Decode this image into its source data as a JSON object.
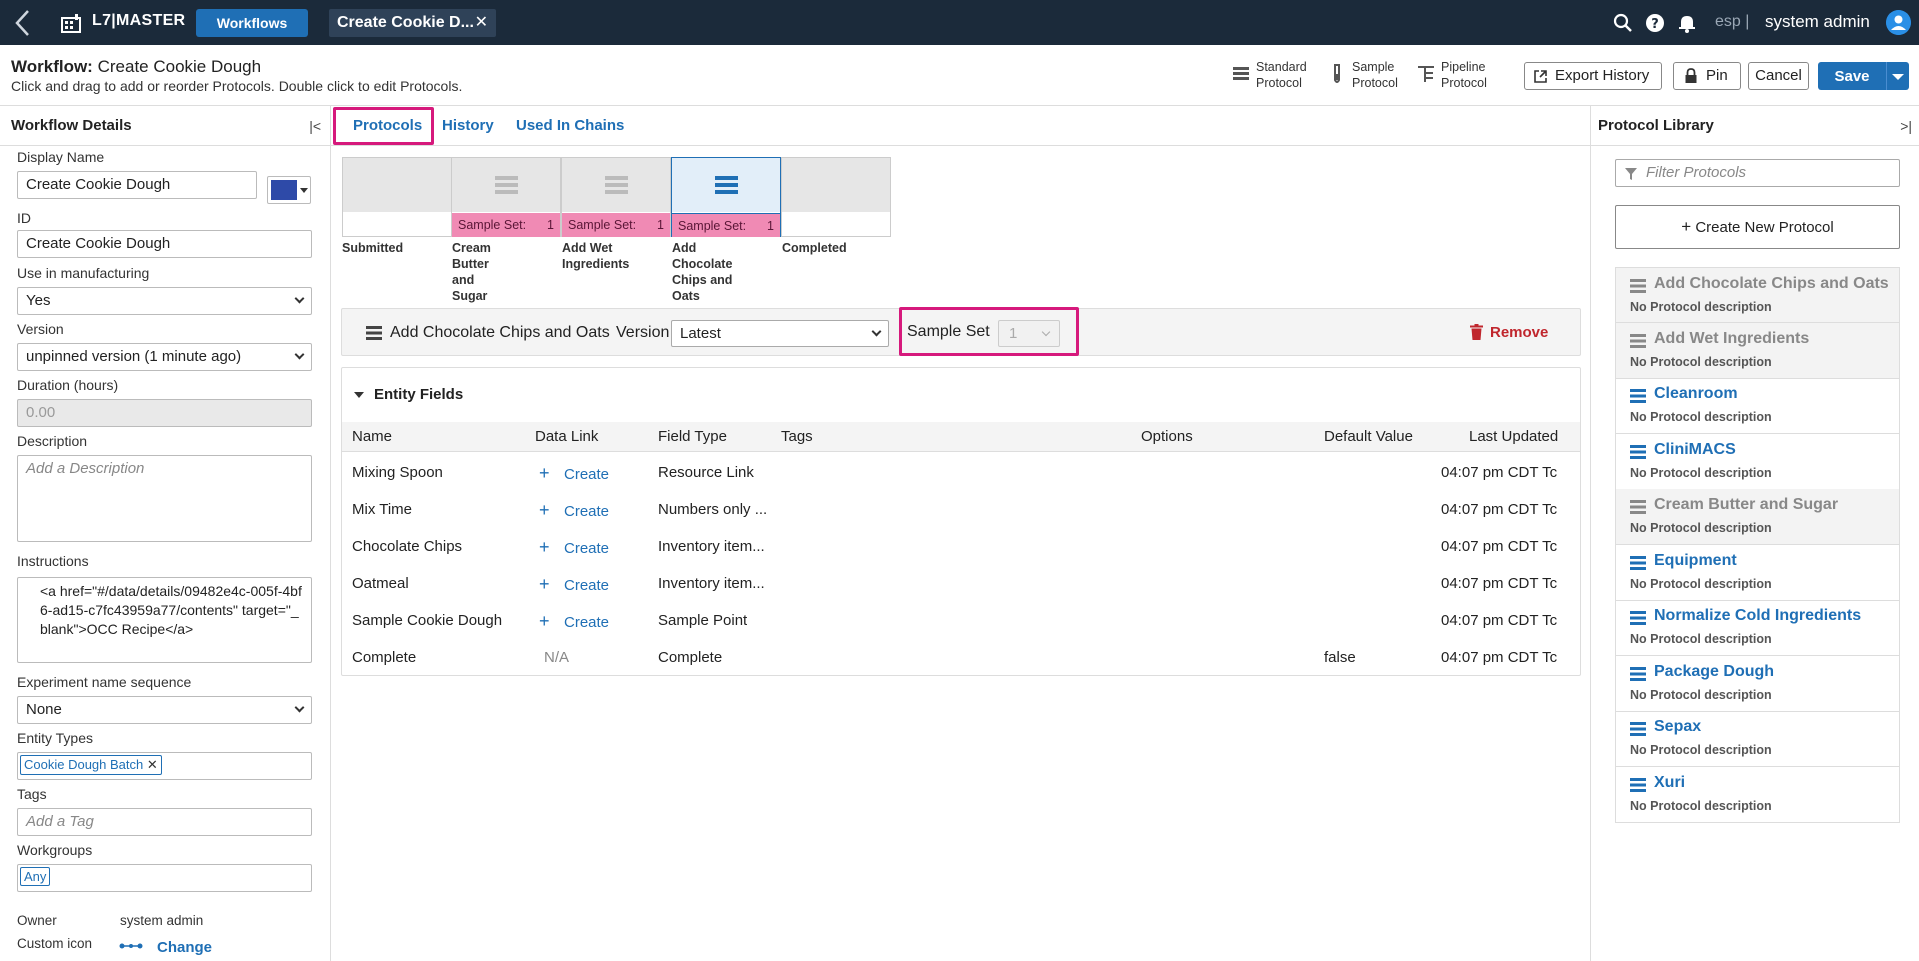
{
  "topbar": {
    "brand": "L7|MASTER",
    "workflows_button": "Workflows",
    "active_tab": "Create Cookie D...",
    "esp": "esp |",
    "user": "system admin",
    "icons": [
      "back-icon",
      "app-logo-icon",
      "close-icon",
      "search-icon",
      "help-icon",
      "bell-icon",
      "avatar-icon"
    ]
  },
  "header": {
    "workflow_label": "Workflow:",
    "workflow_name": "Create Cookie Dough",
    "hint": "Click and drag to add or reorder Protocols. Double click to edit Protocols.",
    "protocol_types": [
      {
        "line1": "Standard",
        "line2": "Protocol"
      },
      {
        "line1": "Sample",
        "line2": "Protocol"
      },
      {
        "line1": "Pipeline",
        "line2": "Protocol"
      }
    ],
    "export_history": "Export History",
    "pin": "Pin",
    "cancel": "Cancel",
    "save": "Save"
  },
  "left": {
    "title": "Workflow Details",
    "display_name_label": "Display Name",
    "display_name": "Create Cookie Dough",
    "color": "#2e4aa8",
    "id_label": "ID",
    "id": "Create Cookie Dough",
    "manufacturing_label": "Use in manufacturing",
    "manufacturing": "Yes",
    "version_label": "Version",
    "version": "unpinned version (1 minute ago)",
    "duration_label": "Duration (hours)",
    "duration": "0.00",
    "description_label": "Description",
    "description_placeholder": "Add a Description",
    "instructions_label": "Instructions",
    "instructions": "<a href=\"#/data/details/09482e4c-005f-4bf6-ad15-c7fc43959a77/contents\" target=\"_blank\">OCC Recipe</a>",
    "sequence_label": "Experiment name sequence",
    "sequence": "None",
    "entity_types_label": "Entity Types",
    "entity_type_chip": "Cookie Dough Batch",
    "tags_label": "Tags",
    "tags_placeholder": "Add a Tag",
    "workgroups_label": "Workgroups",
    "workgroup_chip": "Any",
    "owner_label": "Owner",
    "owner": "system admin",
    "custom_icon_label": "Custom icon",
    "change": "Change"
  },
  "tabs": [
    "Protocols",
    "History",
    "Used In Chains"
  ],
  "steps": [
    {
      "label1": "Submitted",
      "label2": "",
      "bar": "",
      "count": ""
    },
    {
      "label1": "Cream Butter",
      "label2": "and Sugar",
      "bar": "Sample Set:",
      "count": "1"
    },
    {
      "label1": "Add Wet",
      "label2": "Ingredients",
      "bar": "Sample Set:",
      "count": "1"
    },
    {
      "label1": "Add Chocolate",
      "label2": "Chips and Oats",
      "bar": "Sample Set:",
      "count": "1"
    },
    {
      "label1": "Completed",
      "label2": "",
      "bar": "",
      "count": ""
    }
  ],
  "protocol_bar": {
    "name": "Add Chocolate Chips and Oats",
    "version_label": "Version",
    "version": "Latest",
    "sample_set_label": "Sample Set",
    "sample_set": "1",
    "remove": "Remove"
  },
  "entity_fields": {
    "title": "Entity Fields",
    "columns": [
      "Name",
      "Data Link",
      "Field Type",
      "Tags",
      "Options",
      "Default Value",
      "Last Updated"
    ],
    "rows": [
      {
        "name": "Mixing Spoon",
        "link": "Create",
        "type": "Resource Link",
        "tags": "",
        "options": "",
        "default": "",
        "updated": "04:07 pm CDT Tc"
      },
      {
        "name": "Mix Time",
        "link": "Create",
        "type": "Numbers only ...",
        "tags": "",
        "options": "",
        "default": "",
        "updated": "04:07 pm CDT Tc"
      },
      {
        "name": "Chocolate Chips",
        "link": "Create",
        "type": "Inventory item...",
        "tags": "",
        "options": "",
        "default": "",
        "updated": "04:07 pm CDT Tc"
      },
      {
        "name": "Oatmeal",
        "link": "Create",
        "type": "Inventory item...",
        "tags": "",
        "options": "",
        "default": "",
        "updated": "04:07 pm CDT Tc"
      },
      {
        "name": "Sample Cookie Dough",
        "link": "Create",
        "type": "Sample Point",
        "tags": "",
        "options": "",
        "default": "",
        "updated": "04:07 pm CDT Tc"
      },
      {
        "name": "Complete",
        "link": "N/A",
        "type": "Complete",
        "tags": "",
        "options": "",
        "default": "false",
        "updated": "04:07 pm CDT Tc"
      }
    ]
  },
  "library": {
    "title": "Protocol Library",
    "filter_placeholder": "Filter Protocols",
    "create": "Create New Protocol",
    "items": [
      {
        "name": "Add Chocolate Chips and Oats",
        "desc": "No Protocol description",
        "used": true
      },
      {
        "name": "Add Wet Ingredients",
        "desc": "No Protocol description",
        "used": true
      },
      {
        "name": "Cleanroom",
        "desc": "No Protocol description",
        "used": false
      },
      {
        "name": "CliniMACS",
        "desc": "No Protocol description",
        "used": false
      },
      {
        "name": "Cream Butter and Sugar",
        "desc": "No Protocol description",
        "used": true
      },
      {
        "name": "Equipment",
        "desc": "No Protocol description",
        "used": false
      },
      {
        "name": "Normalize Cold Ingredients",
        "desc": "No Protocol description",
        "used": false
      },
      {
        "name": "Package Dough",
        "desc": "No Protocol description",
        "used": false
      },
      {
        "name": "Sepax",
        "desc": "No Protocol description",
        "used": false
      },
      {
        "name": "Xuri",
        "desc": "No Protocol description",
        "used": false
      }
    ]
  },
  "colors": {
    "accent": "#1f6fb5",
    "topbar": "#1b2a3a",
    "highlight": "#d6197c",
    "sample_bar": "#f08ab4",
    "remove": "#c0262d"
  }
}
